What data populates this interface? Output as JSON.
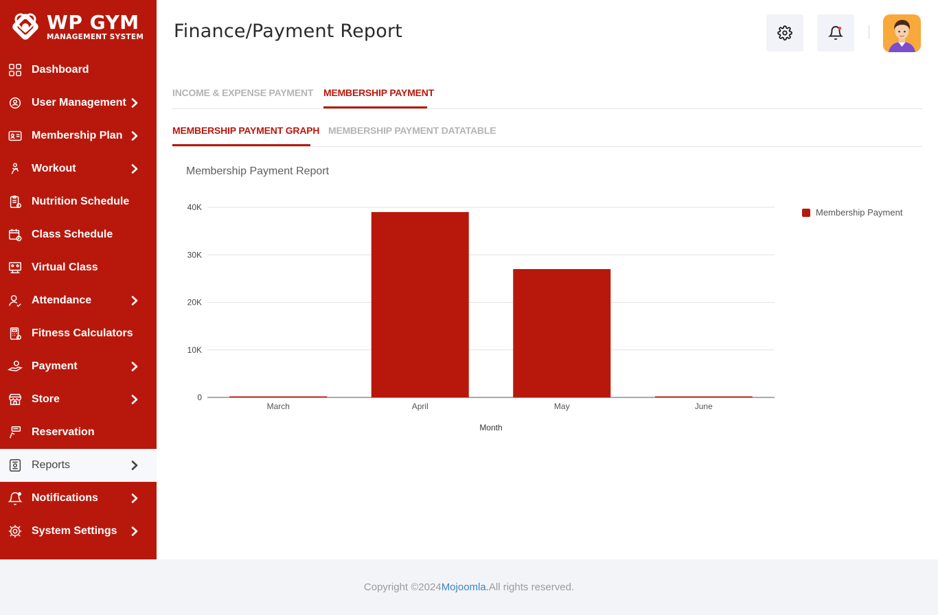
{
  "brand": {
    "title": "WP GYM",
    "subtitle": "MANAGEMENT SYSTEM"
  },
  "sidebar": {
    "items": [
      {
        "label": "Dashboard",
        "icon": "dashboard-icon",
        "chevron": false
      },
      {
        "label": "User Management",
        "icon": "users-gear-icon",
        "chevron": true
      },
      {
        "label": "Membership Plan",
        "icon": "membership-card-icon",
        "chevron": true
      },
      {
        "label": "Workout",
        "icon": "workout-icon",
        "chevron": true
      },
      {
        "label": "Nutrition Schedule",
        "icon": "nutrition-clipboard-icon",
        "chevron": false
      },
      {
        "label": "Class Schedule",
        "icon": "calendar-clock-icon",
        "chevron": false
      },
      {
        "label": "Virtual Class",
        "icon": "virtual-class-icon",
        "chevron": false
      },
      {
        "label": "Attendance",
        "icon": "user-check-icon",
        "chevron": true
      },
      {
        "label": "Fitness Calculators",
        "icon": "calculator-icon",
        "chevron": false
      },
      {
        "label": "Payment",
        "icon": "payment-hand-icon",
        "chevron": true
      },
      {
        "label": "Store",
        "icon": "store-icon",
        "chevron": true
      },
      {
        "label": "Reservation",
        "icon": "reservation-icon",
        "chevron": false
      },
      {
        "label": "Reports",
        "icon": "reports-icon",
        "chevron": true,
        "active": true
      },
      {
        "label": "Notifications",
        "icon": "bell-icon",
        "chevron": true
      },
      {
        "label": "System Settings",
        "icon": "gear-icon",
        "chevron": true
      }
    ]
  },
  "header": {
    "title": "Finance/Payment Report",
    "settings_icon": "gear-icon",
    "notification_icon": "bell-icon"
  },
  "tabs": {
    "primary": [
      {
        "label": "INCOME & EXPENSE PAYMENT",
        "active": false
      },
      {
        "label": "MEMBERSHIP PAYMENT",
        "active": true
      }
    ],
    "secondary": [
      {
        "label": "MEMBERSHIP PAYMENT GRAPH",
        "active": true
      },
      {
        "label": "MEMBERSHIP PAYMENT DATATABLE",
        "active": false
      }
    ]
  },
  "chart_title": "Membership Payment Report",
  "chart_data": {
    "type": "bar",
    "categories": [
      "March",
      "April",
      "May",
      "June"
    ],
    "series": [
      {
        "name": "Membership Payment",
        "values": [
          100,
          39000,
          27000,
          200
        ],
        "color": "#b8180c"
      }
    ],
    "xlabel": "Month",
    "ylabel": "",
    "ylim": [
      0,
      40000
    ],
    "yticks": [
      "0",
      "10K",
      "20K",
      "30K",
      "40K"
    ],
    "grid": true,
    "legend": "right"
  },
  "footer": {
    "prefix": "Copyright ©2024 ",
    "link": "Mojoomla.",
    "suffix": " All rights reserved."
  }
}
